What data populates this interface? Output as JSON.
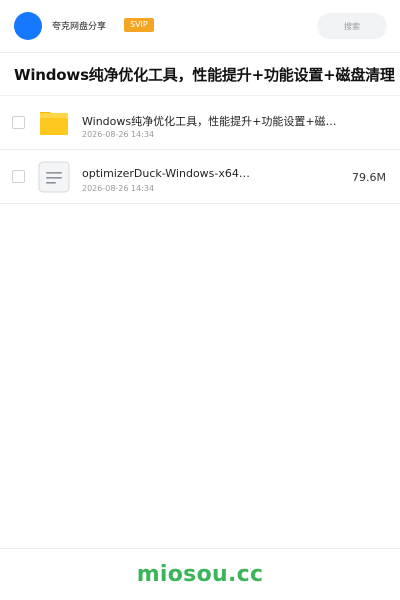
{
  "header": {
    "user_name": "夸克网盘分享",
    "badge": "SVIP",
    "search_placeholder": "搜索"
  },
  "share": {
    "title": "Windows纯净优化工具，性能提升+功能设置+磁盘清理"
  },
  "files": [
    {
      "name": "Windows纯净优化工具，性能提升+功能设置+磁…",
      "date": "2026-08-26 14:34",
      "size": "",
      "type": "folder",
      "icon": "folder-icon"
    },
    {
      "name": "optimizerDuck-Windows-x64…",
      "date": "2026-08-26 14:34",
      "size": "79.6M",
      "type": "file",
      "icon": "document-icon"
    }
  ],
  "footer": {
    "brand": "miosou.cc"
  },
  "colors": {
    "accent": "#1677ff",
    "badge": "#f5a524",
    "folder": "#ffc81e",
    "brand": "#3cb55a"
  }
}
